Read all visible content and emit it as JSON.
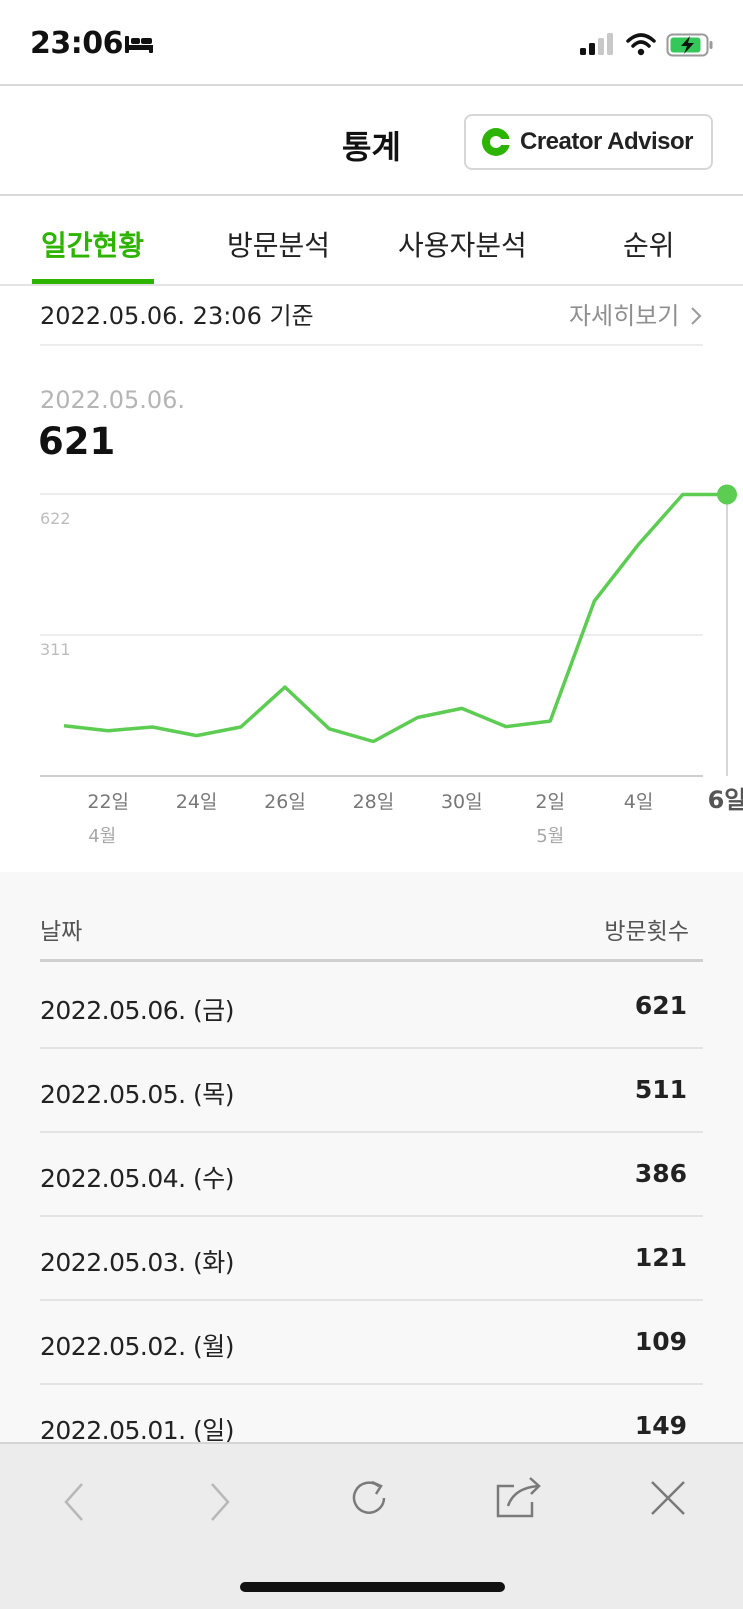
{
  "status": {
    "time": "23:06"
  },
  "header": {
    "title": "통계",
    "creator_advisor": "Creator Advisor"
  },
  "tabs": [
    {
      "label": "일간현황",
      "active": true
    },
    {
      "label": "방문분석",
      "active": false
    },
    {
      "label": "사용자분석",
      "active": false
    },
    {
      "label": "순위",
      "active": false
    }
  ],
  "basis": {
    "text": "2022.05.06. 23:06 기준",
    "detail_link": "자세히보기"
  },
  "summary": {
    "date": "2022.05.06.",
    "value": "621"
  },
  "colors": {
    "accent": "#2db400",
    "line": "#5dcc52"
  },
  "chart_data": {
    "type": "line",
    "x": [
      "4/21",
      "4/22",
      "4/23",
      "4/24",
      "4/25",
      "4/26",
      "4/27",
      "4/28",
      "4/29",
      "4/30",
      "5/1",
      "5/2",
      "5/3",
      "5/4",
      "5/5",
      "5/6"
    ],
    "values": [
      111,
      100,
      108,
      89,
      108,
      196,
      104,
      76,
      129,
      149,
      109,
      121,
      386,
      511,
      621,
      621
    ],
    "series": [
      {
        "name": "",
        "values": [
          111,
          100,
          108,
          89,
          108,
          196,
          104,
          76,
          129,
          149,
          109,
          121,
          386,
          511,
          621,
          621
        ]
      }
    ],
    "ylim": [
      0,
      622
    ],
    "yticks": [
      "622",
      "311"
    ],
    "xtick_labels": [
      "22일",
      "24일",
      "26일",
      "28일",
      "30일",
      "2일",
      "4일",
      "6일"
    ],
    "month_labels": [
      "4월",
      "5월"
    ],
    "grid": true
  },
  "table": {
    "header_date": "날짜",
    "header_count": "방문횟수",
    "rows": [
      {
        "date": "2022.05.06. (금)",
        "count": "621"
      },
      {
        "date": "2022.05.05. (목)",
        "count": "511"
      },
      {
        "date": "2022.05.04. (수)",
        "count": "386"
      },
      {
        "date": "2022.05.03. (화)",
        "count": "121"
      },
      {
        "date": "2022.05.02. (월)",
        "count": "109"
      },
      {
        "date": "2022.05.01. (일)",
        "count": "149"
      }
    ]
  }
}
